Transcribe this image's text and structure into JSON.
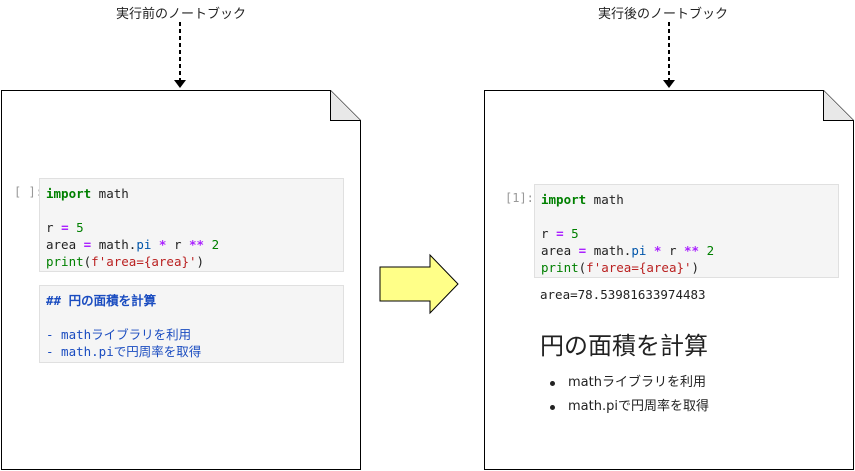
{
  "before": {
    "caption": "実行前のノートブック",
    "prompt": "[ ]:",
    "code": {
      "kw_import": "import",
      "module": " math",
      "var_r": "r ",
      "eq1": "=",
      "val5": " 5",
      "var_area": "area ",
      "eq2": "=",
      "mathpi_prefix": " math.",
      "pi": "pi",
      "mul": " *",
      "r_ref": " r ",
      "pow": "**",
      "val2": " 2",
      "print_fn": "print",
      "print_open": "(",
      "fstring": "f'area={area}'",
      "print_close": ")"
    },
    "markdown_source": {
      "heading": "## 円の面積を計算",
      "item1": "- mathライブラリを利用",
      "item2": "- math.piで円周率を取得"
    }
  },
  "after": {
    "caption": "実行後のノートブック",
    "prompt": "[1]:",
    "code": {
      "kw_import": "import",
      "module": " math",
      "var_r": "r ",
      "eq1": "=",
      "val5": " 5",
      "var_area": "area ",
      "eq2": "=",
      "mathpi_prefix": " math.",
      "pi": "pi",
      "mul": " *",
      "r_ref": " r ",
      "pow": "**",
      "val2": " 2",
      "print_fn": "print",
      "print_open": "(",
      "fstring": "f'area={area}'",
      "print_close": ")"
    },
    "output": "area=78.53981633974483",
    "markdown_rendered": {
      "heading": "円の面積を計算",
      "items": [
        "mathライブラリを利用",
        "math.piで円周率を取得"
      ]
    }
  },
  "colors": {
    "transition_arrow_fill": "#ffff88",
    "keyword": "#008000",
    "operator": "#aa22ff",
    "string": "#ba2121",
    "markdown_source": "#1a4cc0"
  }
}
